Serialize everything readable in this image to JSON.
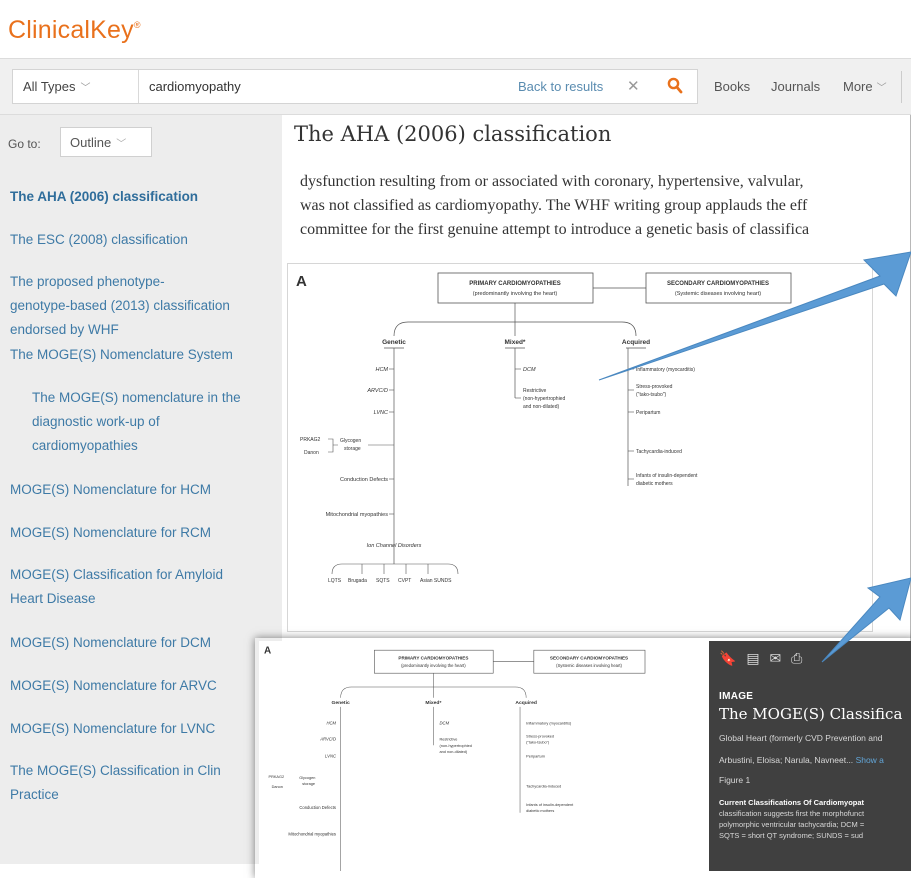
{
  "header": {
    "logo": "ClinicalKey",
    "logo_mark": "®"
  },
  "search": {
    "type_label": "All Types",
    "query": "cardiomyopathy",
    "back_label": "Back to results",
    "nav": [
      "Books",
      "Journals",
      "More"
    ]
  },
  "sidebar": {
    "goto_label": "Go to:",
    "outline_label": "Outline",
    "items": [
      "The AHA (2006) classification",
      "The ESC (2008) classification",
      "The proposed phenotype-",
      "genotype-based (2013) classification",
      "endorsed by WHF",
      "The MOGE(S) Nomenclature System",
      "The MOGE(S) nomenclature in the",
      "diagnostic work-up of",
      "cardiomyopathies",
      "MOGE(S) Nomenclature for HCM",
      "MOGE(S) Nomenclature for RCM",
      "MOGE(S) Classification for Amyloid",
      "Heart Disease",
      "MOGE(S) Nomenclature for DCM",
      "MOGE(S) Nomenclature for ARVC",
      "MOGE(S) Nomenclature for LVNC",
      "The MOGE(S) Classification in Clin",
      "Practice"
    ]
  },
  "main": {
    "title": "The AHA (2006) classification",
    "paragraph": [
      "dysfunction resulting from or associated with coronary, hypertensive, valvular,",
      "was not classified as cardiomyopathy. The WHF writing group applauds the eff",
      "committee for the first genuine attempt to introduce a genetic basis of classifica"
    ]
  },
  "diagram": {
    "panel_letter": "A",
    "primary_title": "PRIMARY CARDIOMYOPATHIES",
    "primary_sub": "(predominantly involving the heart)",
    "secondary_title": "SECONDARY CARDIOMYOPATHIES",
    "secondary_sub": "(Systemic diseases involving heart)",
    "genetic": "Genetic",
    "mixed": "Mixed*",
    "acquired": "Acquired",
    "genetic_items": [
      "HCM",
      "ARVC/D",
      "LVNC"
    ],
    "prkag2": "PRKAG2",
    "danon": "Danon",
    "glycogen": "Glycogen",
    "storage": "storage",
    "conduction": "Conduction Defects",
    "mito": "Mitochondrial myopathies",
    "ion": "Ion Channel Disorders",
    "ion_items": [
      "LQTS",
      "Brugada",
      "SQTS",
      "CVPT",
      "Asian SUNDS"
    ],
    "mixed_items": [
      "DCM",
      "Restrictive",
      "(non-hypertrophied",
      "and non-dilated)"
    ],
    "acquired_items": [
      "Inflammatory (myocarditis)",
      "Stress-provoked",
      "(\"tako-tsubo\")",
      "Peripartum",
      "Tachycardia-induced",
      "Infants of insulin-dependent",
      "diabetic mothers"
    ]
  },
  "overlay": {
    "label": "IMAGE",
    "title": "The MOGE(S) Classifica",
    "source": "Global Heart (formerly CVD Prevention and",
    "authors": "Arbustini, Eloisa; Narula, Navneet...",
    "authors_more": "Show a",
    "figure": "Figure 1",
    "caption_bold": "Current Classifications Of Cardiomyopat",
    "caption_1": "classification suggests first the morphofunct",
    "caption_2": "polymorphic ventricular tachycardia; DCM =",
    "caption_3": "SQTS = short QT syndrome; SUNDS = sud"
  },
  "colors": {
    "brand": "#e9711c",
    "link": "#3e7aa6",
    "arrow": "#5b9bd5",
    "overlay_bg": "#404040"
  }
}
